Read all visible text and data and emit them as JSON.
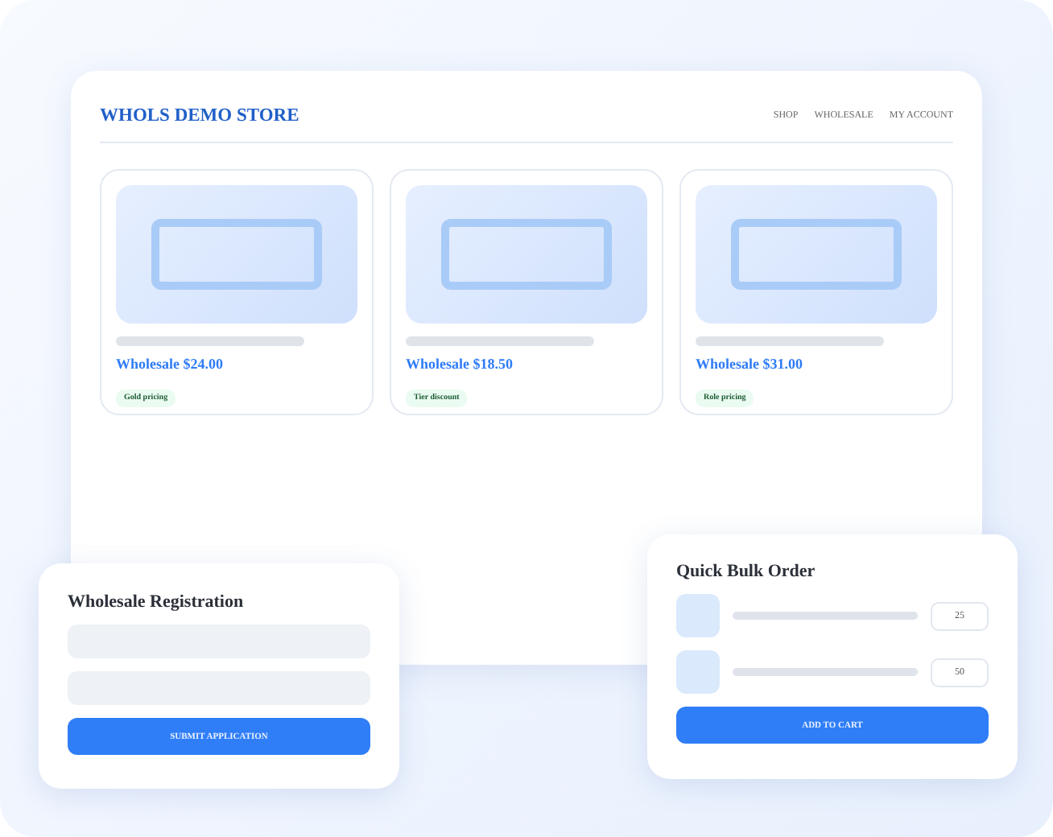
{
  "store": {
    "title": "WHOLS DEMO STORE",
    "nav": [
      "SHOP",
      "WHOLESALE",
      "MY ACCOUNT"
    ],
    "products": [
      {
        "price": "Wholesale $24.00",
        "tag": "Gold pricing"
      },
      {
        "price": "Wholesale $18.50",
        "tag": "Tier discount"
      },
      {
        "price": "Wholesale $31.00",
        "tag": "Role pricing"
      }
    ]
  },
  "registration": {
    "title": "Wholesale Registration",
    "button": "SUBMIT APPLICATION"
  },
  "bulk_order": {
    "title": "Quick Bulk Order",
    "rows": [
      {
        "quantity": "25"
      },
      {
        "quantity": "50"
      }
    ],
    "button": "ADD TO CART"
  }
}
